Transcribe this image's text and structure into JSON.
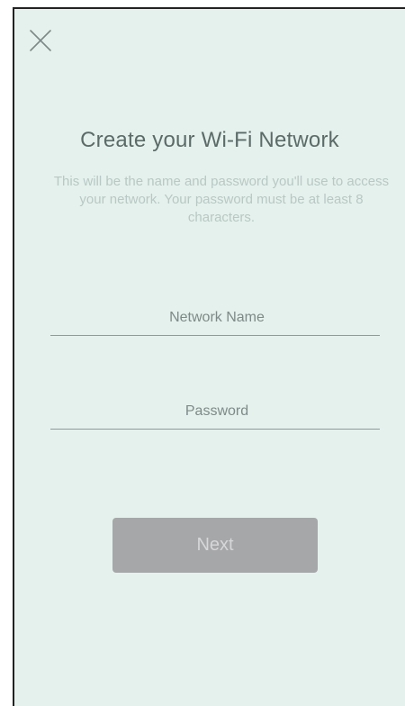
{
  "header": {
    "close_icon": "close-icon"
  },
  "main": {
    "title": "Create your Wi-Fi Network",
    "subtitle": "This will be the name and password you'll use to access your network. Your password must be at least 8 characters.",
    "network_name": {
      "value": "",
      "placeholder": "Network Name"
    },
    "password": {
      "value": "",
      "placeholder": "Password"
    },
    "next_label": "Next"
  },
  "colors": {
    "background": "#e5f1ed",
    "title": "#5c6b68",
    "subtitle": "#b9c8c4",
    "button_disabled": "#a6a7a8"
  }
}
